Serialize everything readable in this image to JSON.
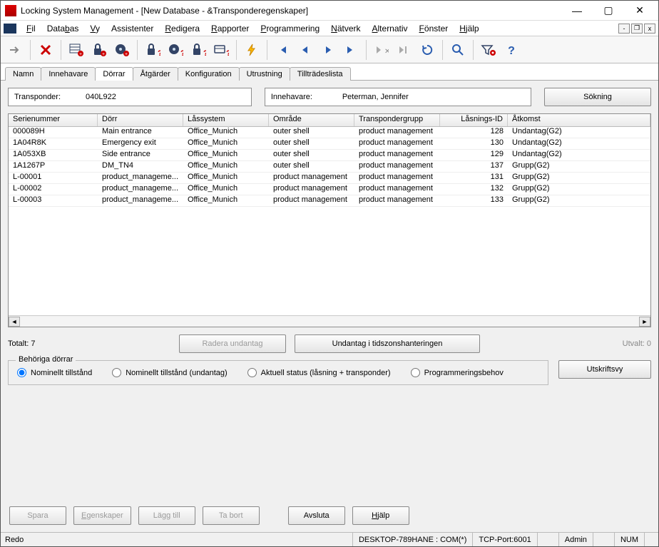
{
  "window": {
    "title": "Locking System Management - [New Database - &Transponderegenskaper]"
  },
  "menu": {
    "items": [
      "Fil",
      "Databas",
      "Vy",
      "Assistenter",
      "Redigera",
      "Rapporter",
      "Programmering",
      "Nätverk",
      "Alternativ",
      "Fönster",
      "Hjälp"
    ]
  },
  "tabs": {
    "items": [
      "Namn",
      "Innehavare",
      "Dörrar",
      "Åtgärder",
      "Konfiguration",
      "Utrustning",
      "Tillträdeslista"
    ],
    "active_index": 2
  },
  "fields": {
    "transponder_label": "Transponder:",
    "transponder_value": "040L922",
    "owner_label": "Innehavare:",
    "owner_value": "Peterman, Jennifer"
  },
  "buttons": {
    "search": "Sökning",
    "delete_exception": "Radera undantag",
    "tz_exception": "Undantag i tidszonshanteringen",
    "print_view": "Utskriftsvy",
    "save": "Spara",
    "props": "Egenskaper",
    "add": "Lägg till",
    "delete": "Ta bort",
    "finish": "Avsluta",
    "help": "Hjälp"
  },
  "table": {
    "headers": {
      "sn": "Serienummer",
      "door": "Dörr",
      "lock": "Låssystem",
      "area": "Område",
      "grp": "Transpondergrupp",
      "lid": "Låsnings-ID",
      "acc": "Åtkomst"
    },
    "rows": [
      {
        "sn": "000089H",
        "door": "Main entrance",
        "lock": "Office_Munich",
        "area": "outer shell",
        "grp": "product management",
        "lid": "128",
        "acc": "Undantag(G2)"
      },
      {
        "sn": "1A04R8K",
        "door": "Emergency exit",
        "lock": "Office_Munich",
        "area": "outer shell",
        "grp": "product management",
        "lid": "130",
        "acc": "Undantag(G2)"
      },
      {
        "sn": "1A053XB",
        "door": "Side entrance",
        "lock": "Office_Munich",
        "area": "outer shell",
        "grp": "product management",
        "lid": "129",
        "acc": "Undantag(G2)"
      },
      {
        "sn": "1A1267P",
        "door": "DM_TN4",
        "lock": "Office_Munich",
        "area": "outer shell",
        "grp": "product management",
        "lid": "137",
        "acc": "Grupp(G2)"
      },
      {
        "sn": "L-00001",
        "door": "product_manageme...",
        "lock": "Office_Munich",
        "area": "product management",
        "grp": "product management",
        "lid": "131",
        "acc": "Grupp(G2)"
      },
      {
        "sn": "L-00002",
        "door": "product_manageme...",
        "lock": "Office_Munich",
        "area": "product management",
        "grp": "product management",
        "lid": "132",
        "acc": "Grupp(G2)"
      },
      {
        "sn": "L-00003",
        "door": "product_manageme...",
        "lock": "Office_Munich",
        "area": "product management",
        "grp": "product management",
        "lid": "133",
        "acc": "Grupp(G2)"
      }
    ]
  },
  "summary": {
    "total_label": "Totalt: 7",
    "selected_label": "Utvalt: 0"
  },
  "radios": {
    "legend": "Behöriga dörrar",
    "r1": "Nominellt tillstånd",
    "r2": "Nominellt tillstånd (undantag)",
    "r3": "Aktuell status (låsning + transponder)",
    "r4": "Programmeringsbehov"
  },
  "status": {
    "ready": "Redo",
    "com": "DESKTOP-789HANE : COM(*)",
    "tcp": "TCP-Port:6001",
    "admin": "Admin",
    "num": "NUM"
  }
}
